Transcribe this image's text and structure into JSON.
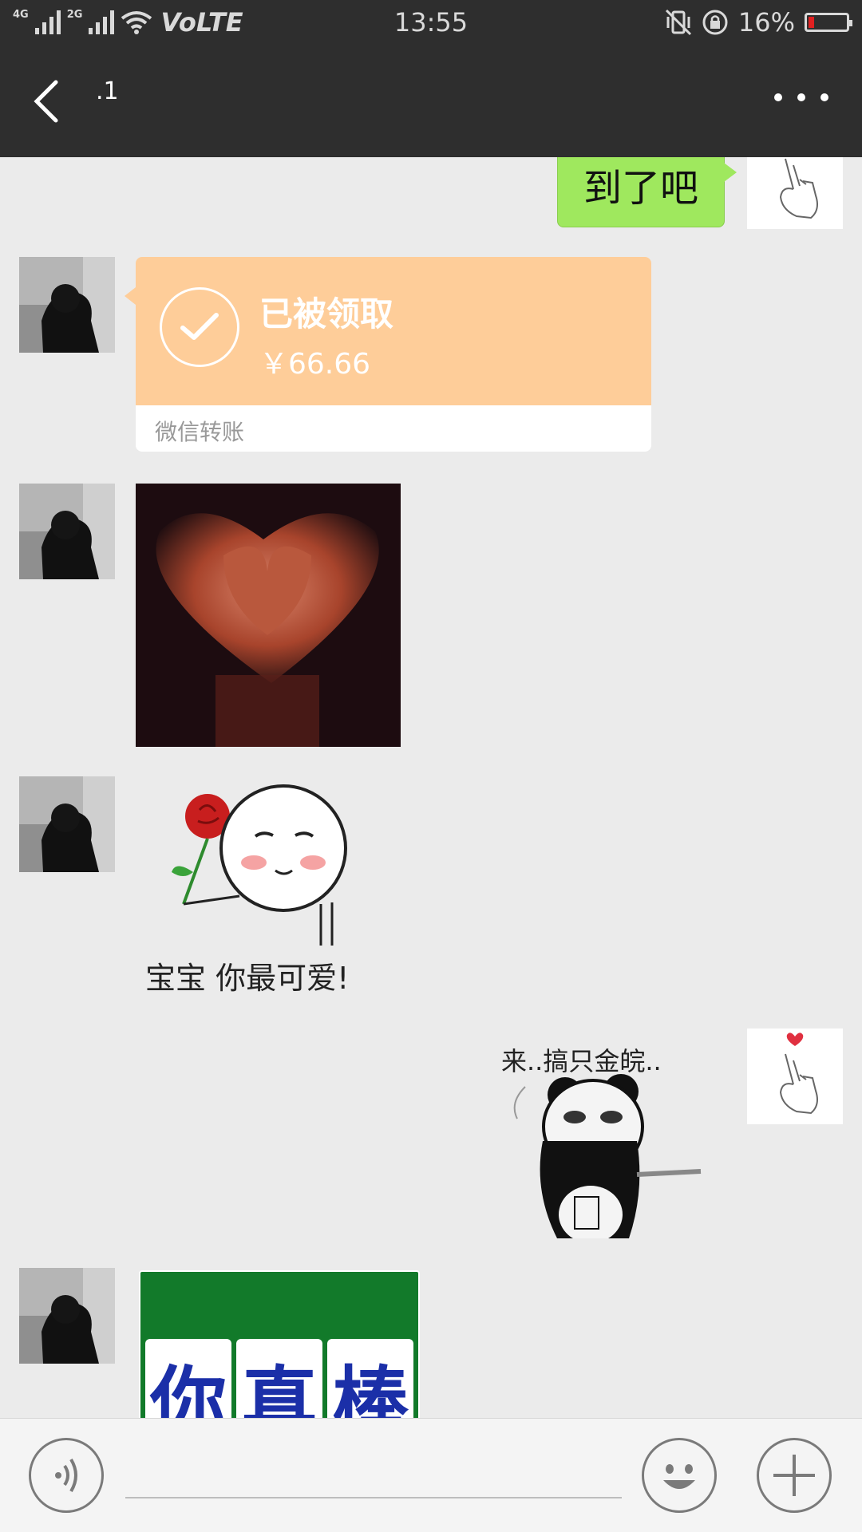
{
  "status_bar": {
    "network_1": "4G",
    "network_2": "2G",
    "volte": "VoLTE",
    "time": "13:55",
    "battery_percent": "16%",
    "battery_level": 0.16,
    "battery_color": "#e02020",
    "icons": [
      "signal-icon",
      "wifi-icon",
      "vibrate-icon",
      "rotation-lock-icon",
      "battery-icon"
    ]
  },
  "nav": {
    "title": ".1",
    "back_icon": "chevron-left-icon",
    "more_icon": "more-dots-icon"
  },
  "messages": [
    {
      "side": "self",
      "type": "text",
      "text": "到了吧"
    },
    {
      "side": "other",
      "type": "transfer",
      "status": "已被领取",
      "amount": "￥66.66",
      "label": "微信转账",
      "color": "#fecd99"
    },
    {
      "side": "other",
      "type": "image",
      "description_icon": "heart-hands-image"
    },
    {
      "side": "other",
      "type": "sticker",
      "caption": "宝宝 你最可爱!"
    },
    {
      "side": "self",
      "type": "sticker",
      "caption": "来..搞只金皖.."
    },
    {
      "side": "other",
      "type": "sticker",
      "tiles": [
        "你",
        "真",
        "棒"
      ]
    }
  ],
  "input_bar": {
    "voice_icon": "voice-icon",
    "emoji_icon": "emoji-icon",
    "plus_icon": "plus-icon",
    "input_value": ""
  },
  "colors": {
    "header_bg": "#2e2e2e",
    "chat_bg": "#ebebeb",
    "bubble_green": "#9fe85e",
    "transfer_orange": "#fecd99"
  }
}
